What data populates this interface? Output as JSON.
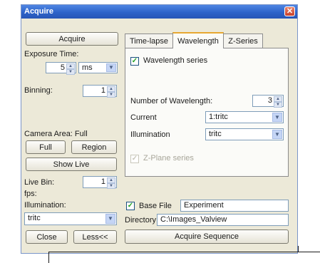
{
  "window": {
    "title": "Acquire"
  },
  "left": {
    "acquire_button": "Acquire",
    "exposure_label": "Exposure Time:",
    "exposure_value": "5",
    "exposure_unit": "ms",
    "binning_label": "Binning:",
    "binning_value": "1",
    "camera_area_label": "Camera Area: Full",
    "full_button": "Full",
    "region_button": "Region",
    "show_live_button": "Show Live",
    "live_bin_label": "Live Bin:",
    "live_bin_value": "1",
    "fps_label": "fps:",
    "illumination_label": "Illumination:",
    "illumination_value": "tritc",
    "close_button": "Close",
    "less_button": "Less<<"
  },
  "tabs": [
    {
      "label": "Time-lapse"
    },
    {
      "label": "Wavelength"
    },
    {
      "label": "Z-Series"
    }
  ],
  "wavelength": {
    "series_label": "Wavelength series",
    "number_label": "Number of Wavelength:",
    "number_value": "3",
    "current_label": "Current",
    "current_value": "1:tritc",
    "illumination_label": "Illumination",
    "illumination_value": "tritc",
    "zplane_label": "Z-Plane series"
  },
  "file": {
    "base_file_label": "Base File",
    "base_file_value": "Experiment",
    "directory_label": "Directory",
    "directory_value": "C:\\Images_Valview",
    "acquire_sequence_button": "Acquire Sequence"
  },
  "icons": {
    "close": "close-icon",
    "spin": "spin-arrows-icon",
    "dropdown": "chevron-down-icon",
    "check": "checkmark-icon"
  },
  "colors": {
    "titlebar": "#2d63c9",
    "dialog_bg": "#ece9d8",
    "close_button": "#c9412a",
    "active_tab_accent": "#e8a832",
    "check_mark": "#21a121"
  }
}
